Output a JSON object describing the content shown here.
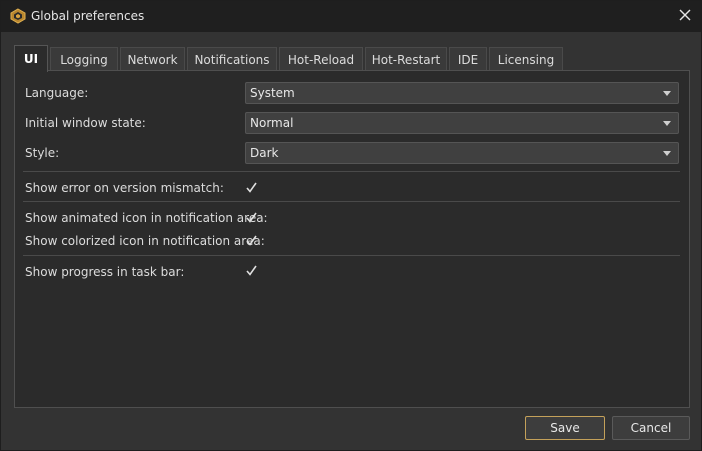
{
  "window": {
    "title": "Global preferences",
    "close_glyph": "✕"
  },
  "tabs": [
    {
      "label": "UI",
      "active": true
    },
    {
      "label": "Logging"
    },
    {
      "label": "Network"
    },
    {
      "label": "Notifications"
    },
    {
      "label": "Hot-Reload"
    },
    {
      "label": "Hot-Restart"
    },
    {
      "label": "IDE"
    },
    {
      "label": "Licensing"
    }
  ],
  "settings": {
    "language": {
      "label": "Language:",
      "value": "System"
    },
    "initial_window_state": {
      "label": "Initial window state:",
      "value": "Normal"
    },
    "style": {
      "label": "Style:",
      "value": "Dark"
    },
    "show_error_version_mismatch": {
      "label": "Show error on version mismatch:",
      "checked": true
    },
    "show_animated_icon": {
      "label": "Show animated icon in notification area:",
      "checked": true
    },
    "show_colorized_icon": {
      "label": "Show colorized icon in notification area:",
      "checked": true
    },
    "show_progress_taskbar": {
      "label": "Show progress in task bar:",
      "checked": true
    }
  },
  "buttons": {
    "save": "Save",
    "cancel": "Cancel"
  },
  "colors": {
    "accent": "#c4a15a",
    "background": "#333333",
    "panel": "#2b2b2b"
  },
  "icons": {
    "app": "app-logo-icon",
    "close": "close-icon",
    "check": "checkmark-icon",
    "dropdown": "chevron-down-icon"
  }
}
